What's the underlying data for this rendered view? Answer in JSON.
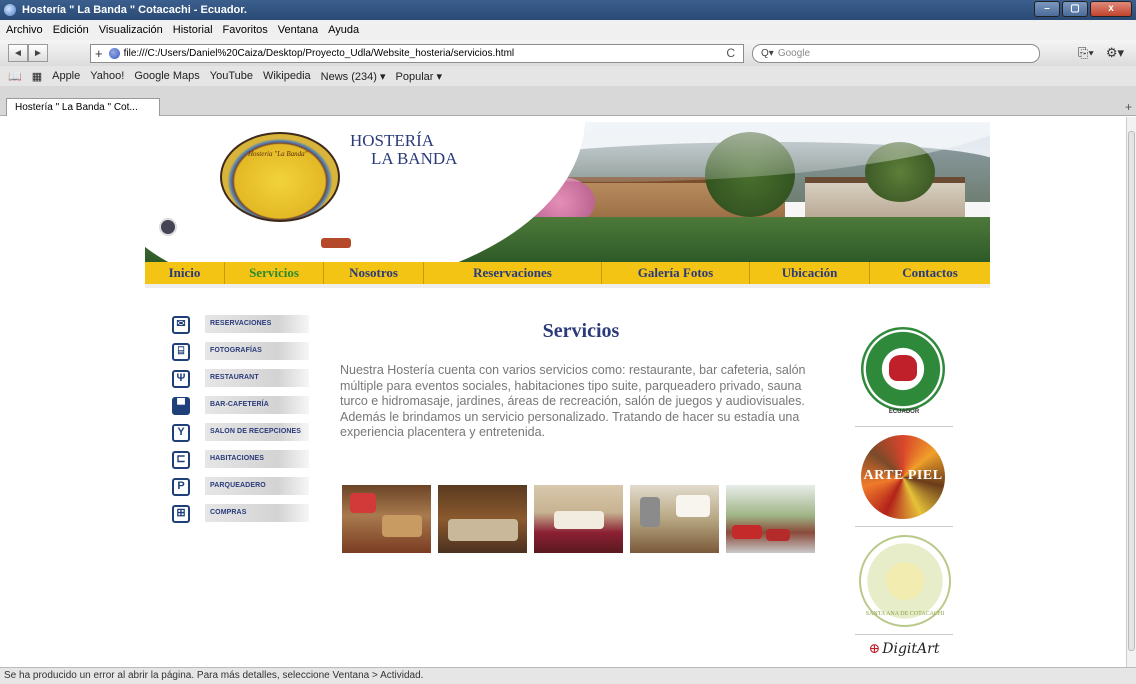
{
  "window": {
    "title": "Hostería \" La Banda \" Cotacachi - Ecuador.",
    "min_label": "–",
    "max_label": "▢",
    "close_label": "x"
  },
  "menu": [
    "Archivo",
    "Edición",
    "Visualización",
    "Historial",
    "Favoritos",
    "Ventana",
    "Ayuda"
  ],
  "nav": {
    "back_label": "◄",
    "forward_label": "►",
    "plus_label": "+",
    "url": "file:///C:/Users/Daniel%20Caiza/Desktop/Proyecto_Udla/Website_hosteria/servicios.html",
    "reload_label": "C",
    "search_placeholder": "Google",
    "search_prefix": "Q▾",
    "page_menu_label": "⎘▾",
    "settings_label": "⚙▾"
  },
  "bookmarks": [
    "Apple",
    "Yahoo!",
    "Google Maps",
    "YouTube",
    "Wikipedia",
    "News (234) ▾",
    "Popular ▾"
  ],
  "bookmark_icons": {
    "book": "📖",
    "grid": "▦"
  },
  "tab": {
    "label": "Hostería \" La Banda \" Cot...",
    "add_label": "+"
  },
  "status": "Se ha producido un error al abrir la página. Para más detalles, seleccione Ventana > Actividad.",
  "site": {
    "title_line1": "HOSTERÍA",
    "title_line2": "LA BANDA",
    "logo_text": "Hosteria \"La Banda\"",
    "nav": [
      "Inicio",
      "Servicios",
      "Nosotros",
      "Reservaciones",
      "Galería Fotos",
      "Ubicación",
      "Contactos"
    ],
    "active_nav": "Servicios",
    "side_menu": [
      {
        "label": "RESERVACIONES",
        "icon": "envelope-icon",
        "glyph": "✉"
      },
      {
        "label": "FOTOGRAFÍAS",
        "icon": "camera-icon",
        "glyph": "⌸"
      },
      {
        "label": "RESTAURANT",
        "icon": "fork-knife-icon",
        "glyph": "Ψ"
      },
      {
        "label": "BAR-CAFETERÍA",
        "icon": "coffee-cup-icon",
        "glyph": "▀"
      },
      {
        "label": "SALON DE RECEPCIONES",
        "icon": "glass-icon",
        "glyph": "Y"
      },
      {
        "label": "HABITACIONES",
        "icon": "bed-icon",
        "glyph": "⊏"
      },
      {
        "label": "PARQUEADERO",
        "icon": "parking-icon",
        "glyph": "P"
      },
      {
        "label": "COMPRAS",
        "icon": "cart-icon",
        "glyph": "⊞"
      }
    ],
    "heading": "Servicios",
    "body": "Nuestra Hostería cuenta con varios servicios como: restaurante, bar cafeteria, salón múltiple para eventos sociales, habitaciones tipo suite, parqueadero privado, sauna turco e hidromasaje, jardines, áreas de recreación, salón de juegos y audiovisuales. Además le brindamos un servicio personalizado. Tratando de hacer su estadía una experiencia placentera y entretenida.",
    "partner_logos": {
      "seal_text": "ECUADOR",
      "arte_piel": "ARTE PIEL",
      "comunidad": "SANTA ANA DE COTACACHI",
      "digitart": "DigitArt",
      "digitart_mark": "⊕"
    }
  }
}
